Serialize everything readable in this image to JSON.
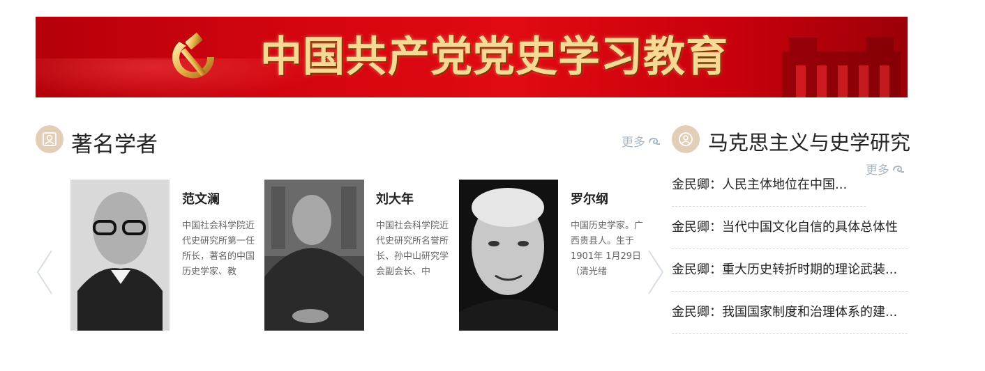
{
  "banner": {
    "title": "中国共产党党史学习教育"
  },
  "scholars": {
    "title": "著名学者",
    "more_label": "更多",
    "items": [
      {
        "name": "范文澜",
        "desc": "中国社会科学院近代史研究所第一任所长，著名的中国历史学家、教"
      },
      {
        "name": "刘大年",
        "desc": "中国社会科学院近代史研究所名誉所长、孙中山研究学会副会长、中"
      },
      {
        "name": "罗尔纲",
        "desc": "中国历史学家。广西贵县人。生于1901年 1月29日（清光绪"
      }
    ]
  },
  "marxism": {
    "title": "马克思主义与史学研究",
    "more_label": "更多",
    "articles": [
      "金民卿：人民主体地位在中国...",
      "金民卿：当代中国文化自信的具体总体性",
      "金民卿：重大历史转折时期的理论武装...",
      "金民卿：我国国家制度和治理体系的建..."
    ]
  },
  "colors": {
    "banner_red": "#d4050f",
    "gold": "#f6d995",
    "icon_bg": "#e2cdb6",
    "more_blue": "#a9b8c8"
  }
}
